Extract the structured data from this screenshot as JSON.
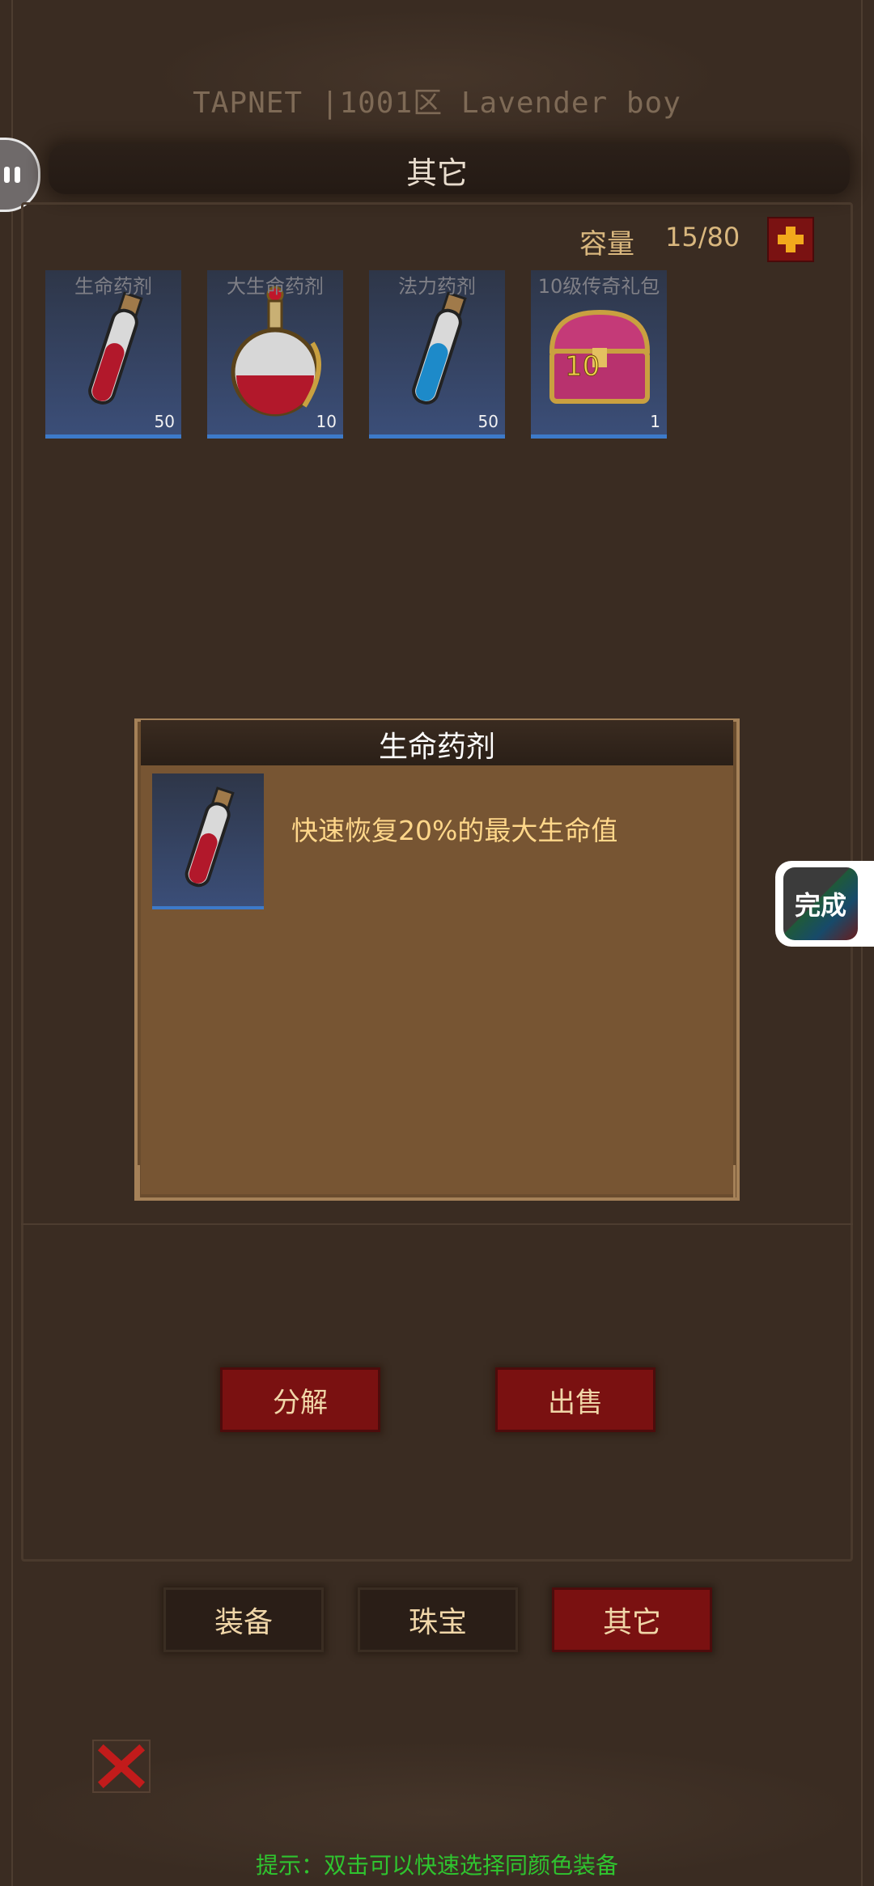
{
  "header": {
    "title": "TAPNET |1001区 Lavender boy"
  },
  "section": {
    "title": "其它"
  },
  "capacity": {
    "label": "容量",
    "value": "15/80"
  },
  "items": [
    {
      "name": "生命药剂",
      "count": "50",
      "icon": "red-potion-vial-icon"
    },
    {
      "name": "大生命药剂",
      "count": "10",
      "icon": "large-red-potion-flask-icon"
    },
    {
      "name": "法力药剂",
      "count": "50",
      "icon": "blue-potion-vial-icon"
    },
    {
      "name": "10级传奇礼包",
      "count": "1",
      "icon": "treasure-chest-icon",
      "badge": "10"
    }
  ],
  "detail": {
    "title": "生命药剂",
    "description": "快速恢复20%的最大生命值"
  },
  "actions": {
    "decompose": "分解",
    "sell": "出售"
  },
  "tabs": [
    {
      "label": "装备",
      "active": false
    },
    {
      "label": "珠宝",
      "active": false
    },
    {
      "label": "其它",
      "active": true
    }
  ],
  "floating": {
    "complete": "完成"
  },
  "hint": "提示：双击可以快速选择同颜色装备",
  "colors": {
    "accent_red": "#7a1111",
    "gold_text": "#d9b77e",
    "hint_green": "#2fc42f",
    "panel_brown": "#775533"
  }
}
